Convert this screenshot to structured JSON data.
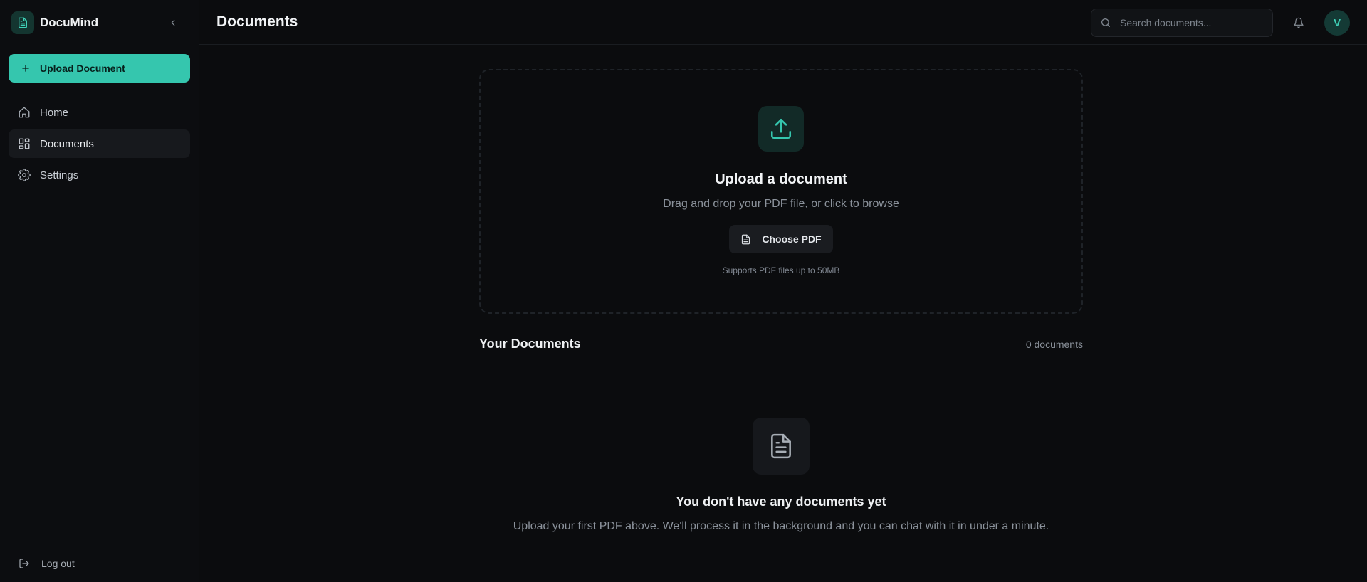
{
  "sidebar": {
    "brand_name": "DocuMind",
    "upload_label": "Upload Document",
    "nav": [
      {
        "label": "Home",
        "icon": "home-icon"
      },
      {
        "label": "Documents",
        "icon": "grid-icon",
        "active": true
      },
      {
        "label": "Settings",
        "icon": "gear-icon"
      }
    ],
    "logout_label": "Log out"
  },
  "header": {
    "title": "Documents",
    "search_placeholder": "Search documents...",
    "avatar_initial": "V"
  },
  "upload": {
    "title": "Upload a document",
    "subtitle": "Drag and drop your PDF file, or click to browse",
    "button_label": "Choose PDF",
    "note": "Supports PDF files up to 50MB"
  },
  "documents": {
    "title": "Your Documents",
    "count_label": "0 documents",
    "empty_title": "You don't have any documents yet",
    "empty_subtitle": "Upload your first PDF above. We'll process it in the background and you can chat with it in under a minute."
  },
  "colors": {
    "accent": "#35c6ae",
    "background": "#0b0c0e",
    "sidebar_active": "#17191d"
  }
}
